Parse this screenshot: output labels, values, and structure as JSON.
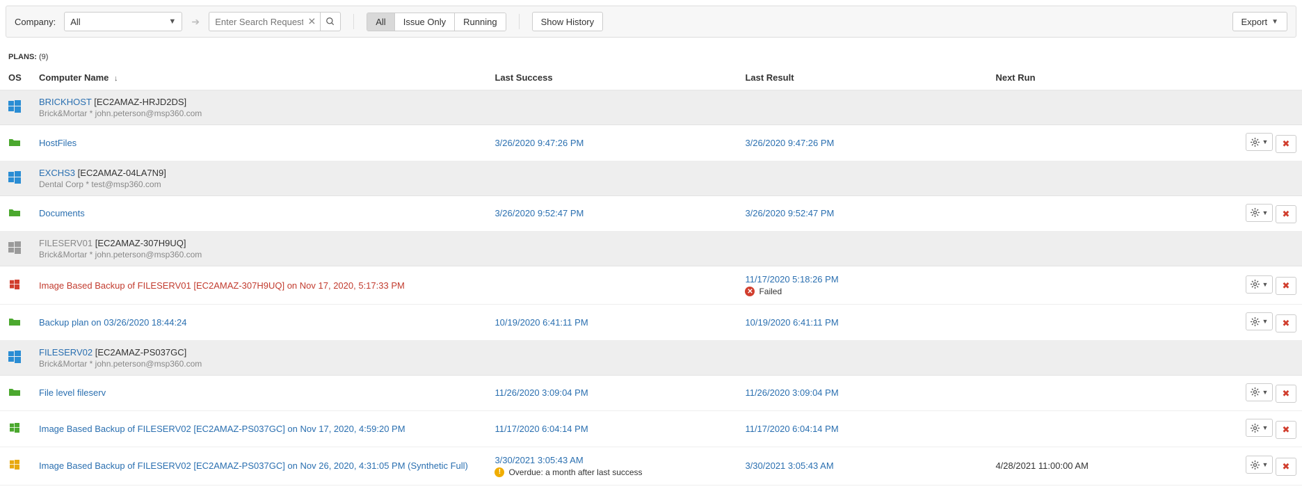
{
  "toolbar": {
    "company_label": "Company:",
    "company_value": "All",
    "search_placeholder": "Enter Search Request",
    "filters": [
      "All",
      "Issue Only",
      "Running"
    ],
    "filter_active_index": 0,
    "show_history_label": "Show History",
    "export_label": "Export"
  },
  "plans_header": {
    "label": "PLANS:",
    "count": "(9)"
  },
  "columns": {
    "os": "OS",
    "name": "Computer Name",
    "last_success": "Last Success",
    "last_result": "Last Result",
    "next_run": "Next Run"
  },
  "groups": [
    {
      "name": "BRICKHOST",
      "host": "[EC2AMAZ-HRJD2DS]",
      "sub": "Brick&Mortar * john.peterson@msp360.com",
      "os_active": true,
      "plans": [
        {
          "icon": "folder-green",
          "plan_name": "HostFiles",
          "last_success": "3/26/2020 9:47:26 PM",
          "last_result": "3/26/2020 9:47:26 PM",
          "next_run": ""
        }
      ]
    },
    {
      "name": "EXCHS3",
      "host": "[EC2AMAZ-04LA7N9]",
      "sub": "Dental Corp * test@msp360.com",
      "os_active": true,
      "plans": [
        {
          "icon": "folder-green",
          "plan_name": "Documents",
          "last_success": "3/26/2020 9:52:47 PM",
          "last_result": "3/26/2020 9:52:47 PM",
          "next_run": ""
        }
      ]
    },
    {
      "name": "FILESERV01",
      "host": "[EC2AMAZ-307H9UQ]",
      "sub": "Brick&Mortar * john.peterson@msp360.com",
      "os_active": false,
      "plans": [
        {
          "icon": "win-red",
          "plan_name": "Image Based Backup of FILESERV01 [EC2AMAZ-307H9UQ] on Nov 17, 2020, 5:17:33 PM",
          "plan_red": true,
          "last_success": "",
          "last_result": "11/17/2020 5:18:26 PM",
          "result_status": {
            "type": "err",
            "text": "Failed"
          },
          "next_run": ""
        },
        {
          "icon": "folder-green",
          "plan_name": "Backup plan on 03/26/2020 18:44:24",
          "last_success": "10/19/2020 6:41:11 PM",
          "last_result": "10/19/2020 6:41:11 PM",
          "next_run": ""
        }
      ]
    },
    {
      "name": "FILESERV02",
      "host": "[EC2AMAZ-PS037GC]",
      "sub": "Brick&Mortar * john.peterson@msp360.com",
      "os_active": true,
      "plans": [
        {
          "icon": "folder-green",
          "plan_name": "File level fileserv",
          "last_success": "11/26/2020 3:09:04 PM",
          "last_result": "11/26/2020 3:09:04 PM",
          "next_run": ""
        },
        {
          "icon": "win-green",
          "plan_name": "Image Based Backup of FILESERV02 [EC2AMAZ-PS037GC] on Nov 17, 2020, 4:59:20 PM",
          "last_success": "11/17/2020 6:04:14 PM",
          "last_result": "11/17/2020 6:04:14 PM",
          "next_run": ""
        },
        {
          "icon": "win-yellow",
          "plan_name": "Image Based Backup of FILESERV02 [EC2AMAZ-PS037GC] on Nov 26, 2020, 4:31:05 PM (Synthetic Full)",
          "last_success": "3/30/2021 3:05:43 AM",
          "success_status": {
            "type": "warn",
            "text": "Overdue: a month after last success"
          },
          "last_result": "3/30/2021 3:05:43 AM",
          "next_run": "4/28/2021 11:00:00 AM"
        }
      ]
    }
  ]
}
